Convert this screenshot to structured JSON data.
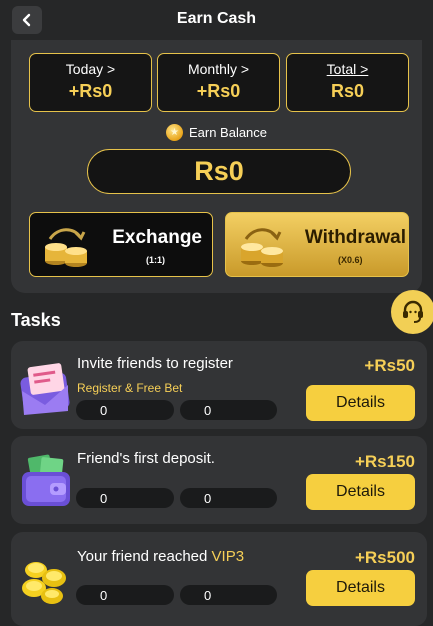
{
  "header": {
    "title": "Earn Cash",
    "back_icon": "chevron-left-icon"
  },
  "stats": [
    {
      "label": "Today >",
      "value": "+Rs0"
    },
    {
      "label": "Monthly >",
      "value": "+Rs0"
    },
    {
      "label": "Total >",
      "value": "Rs0"
    }
  ],
  "earn_balance": {
    "label": "Earn Balance",
    "value": "Rs0",
    "icon": "star-coin-icon"
  },
  "actions": {
    "exchange": {
      "title": "Exchange",
      "sub": "(1:1)"
    },
    "withdrawal": {
      "title": "Withdrawal",
      "sub": "(X0.6)"
    }
  },
  "tasks_title": "Tasks",
  "support_icon": "headset-support-icon",
  "tasks": [
    {
      "title": "Invite friends to register",
      "subtitle": "Register & Free Bet",
      "reward": "+Rs50",
      "progress_a": "0",
      "progress_b": "0",
      "button": "Details",
      "icon": "envelope-icon"
    },
    {
      "title": "Friend's first deposit.",
      "reward": "+Rs150",
      "progress_a": "0",
      "progress_b": "0",
      "button": "Details",
      "icon": "wallet-icon"
    },
    {
      "title_prefix": "Your friend reached ",
      "title_highlight": "VIP3",
      "reward": "+Rs500",
      "progress_a": "0",
      "progress_b": "0",
      "button": "Details",
      "icon": "gold-coins-icon"
    }
  ],
  "colors": {
    "accent": "#f6cf57",
    "button": "#f6cf3f",
    "background": "#262728",
    "card": "#333436"
  }
}
